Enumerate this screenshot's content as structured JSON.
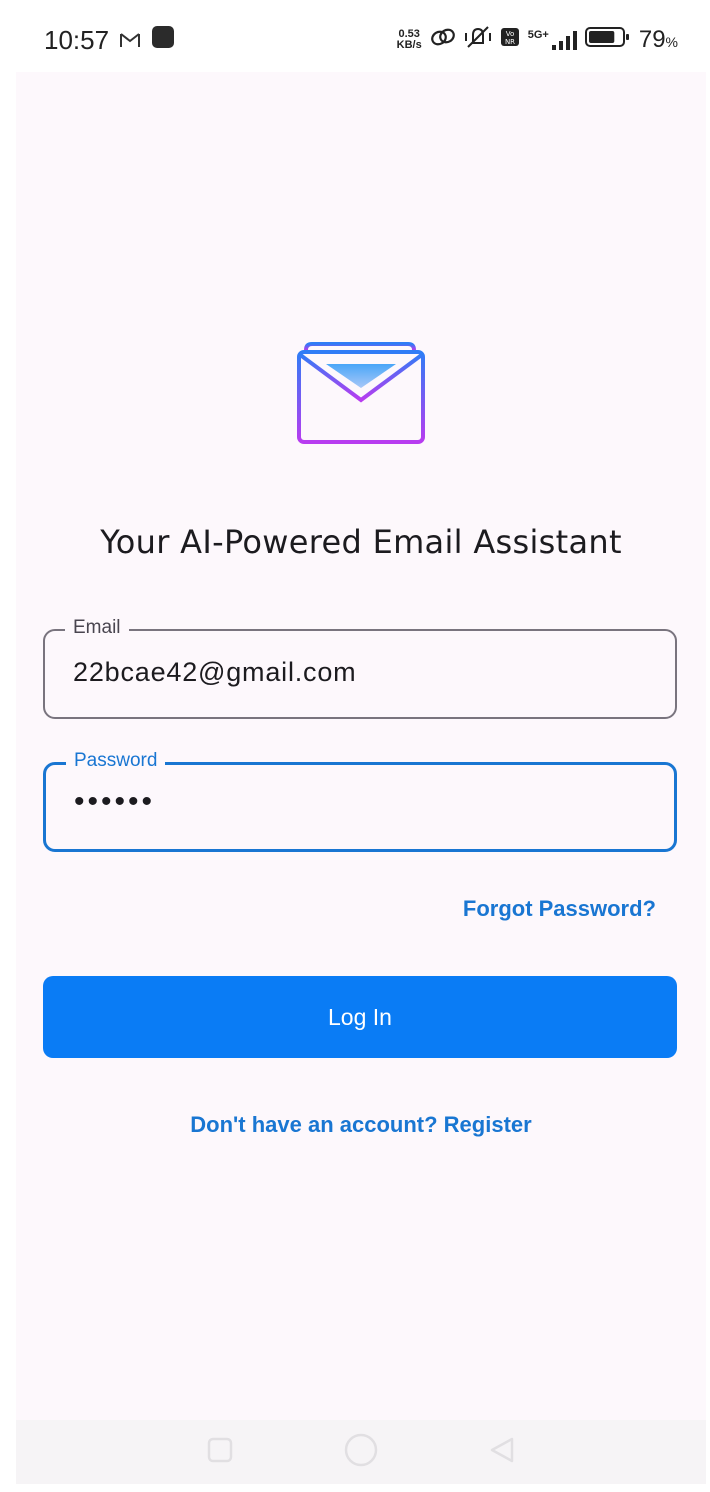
{
  "status_bar": {
    "time": "10:57",
    "net_speed_value": "0.53",
    "net_speed_unit": "KB/s",
    "network_type": "5G+",
    "battery_percent": "79",
    "battery_unit": "%",
    "battery_level": 0.79
  },
  "app": {
    "tagline": "Your AI-Powered Email Assistant",
    "logo_icon": "envelope-icon",
    "colors": {
      "primary": "#1976d2",
      "button": "#0a7cf5",
      "logo_gradient_start": "#2f7df6",
      "logo_gradient_end": "#b83cf0"
    }
  },
  "form": {
    "email": {
      "label": "Email",
      "value": "22bcae42@gmail.com"
    },
    "password": {
      "label": "Password",
      "value": "••••••"
    },
    "forgot_label": "Forgot Password?",
    "login_label": "Log In",
    "register_label": "Don't have an account? Register"
  }
}
